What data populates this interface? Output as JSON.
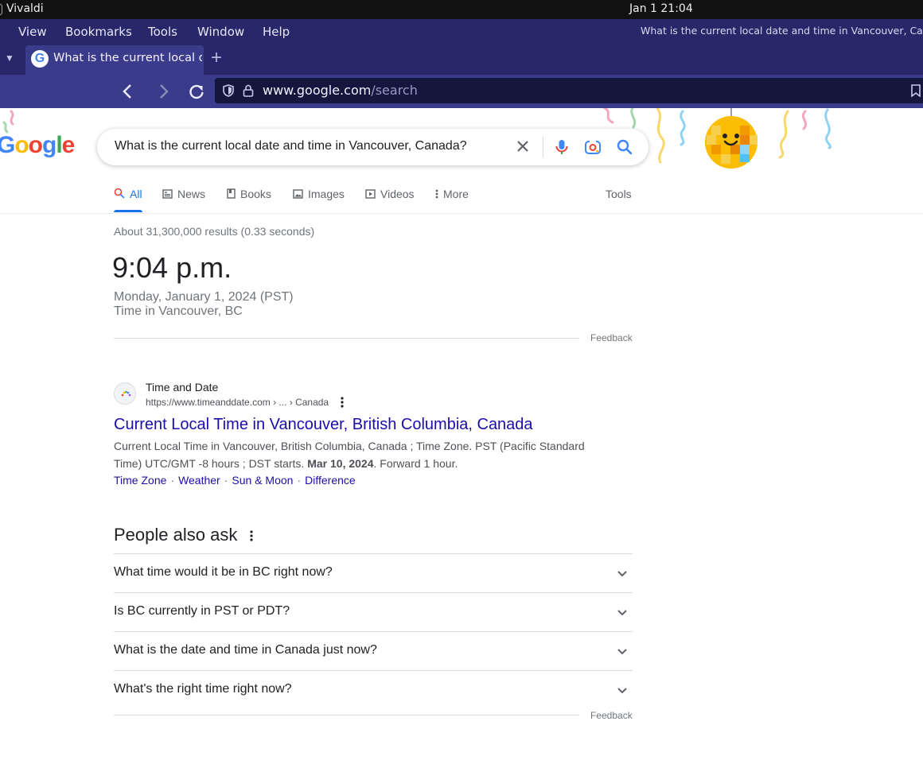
{
  "os": {
    "app_name": "Vivaldi",
    "clock": "Jan 1  21:04"
  },
  "menu": {
    "items": [
      "View",
      "Bookmarks",
      "Tools",
      "Window",
      "Help"
    ],
    "window_title": "What is the current local date and time in Vancouver, Canada? -"
  },
  "tab": {
    "title": "What is the current local date and time in Vancouver, Canada?",
    "favicon": "G"
  },
  "address": {
    "host": "www.google.com",
    "path": "/search"
  },
  "search": {
    "query": "What is the current local date and time in Vancouver, Canada?",
    "logo": "Google",
    "tabs": [
      {
        "label": "All",
        "icon": "search-icon",
        "active": true
      },
      {
        "label": "News",
        "icon": "news-icon"
      },
      {
        "label": "Books",
        "icon": "book-icon"
      },
      {
        "label": "Images",
        "icon": "image-icon"
      },
      {
        "label": "Videos",
        "icon": "video-icon"
      },
      {
        "label": "More",
        "icon": "more-vertical-icon"
      }
    ],
    "tools_label": "Tools",
    "stats": "About 31,300,000 results (0.33 seconds)"
  },
  "answer": {
    "time": "9:04 p.m.",
    "date": "Monday, January 1, 2024 (PST)",
    "place": "Time in Vancouver, BC",
    "feedback": "Feedback"
  },
  "result": {
    "site_name": "Time and Date",
    "site_url": "https://www.timeanddate.com › ... › Canada",
    "title": "Current Local Time in Vancouver, British Columbia, Canada",
    "snippet_a": "Current Local Time in Vancouver, British Columbia, Canada ; Time Zone. PST (Pacific Standard Time) UTC/GMT -8 hours ; DST starts. ",
    "snippet_bold": "Mar 10, 2024",
    "snippet_b": ". Forward 1 hour.",
    "sitelinks": [
      "Time Zone",
      "Weather",
      "Sun & Moon",
      "Difference"
    ]
  },
  "paa": {
    "title": "People also ask",
    "questions": [
      "What time would it be in BC right now?",
      "Is BC currently in PST or PDT?",
      "What is the date and time in Canada just now?",
      "What's the right time right now?"
    ],
    "feedback": "Feedback"
  },
  "colors": {
    "menu_bg": "#27276a",
    "url_bg": "#14163d",
    "link": "#1a0dab",
    "active_tab": "#1a73e8"
  }
}
